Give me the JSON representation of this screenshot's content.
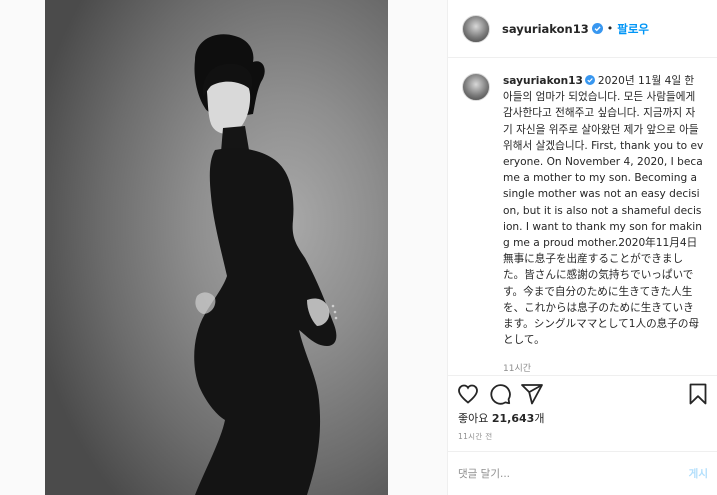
{
  "header": {
    "username": "sayuriakon13",
    "separator": "•",
    "follow_label": "팔로우"
  },
  "caption": {
    "username": "sayuriakon13",
    "text": "2020년 11월 4일 한 아들의 엄마가 되었습니다. 모든 사람들에게 감사한다고 전해주고 싶습니다. 지금까지 자기 자신을 위주로 살아왔던 제가 앞으로 아들 위해서 살겠습니다. First, thank you to everyone. On November 4, 2020, I became a mother to my son. Becoming a single mother was not an easy decision, but it is also not a shameful decision. I want to thank my son for making me a proud mother.2020年11月4日無事に息子を出産することができました。皆さんに感謝の気持ちでいっぱいです。今まで自分のために生きてきた人生を、これからは息子のために生きていきます。シングルママとして1人の息子の母として。",
    "time": "11시간"
  },
  "actions": {
    "like_icon": "heart-icon",
    "comment_icon": "comment-icon",
    "share_icon": "share-icon",
    "save_icon": "bookmark-icon"
  },
  "likes": {
    "prefix": "좋아요 ",
    "count": "21,643",
    "suffix": "개"
  },
  "post_time": "11시간 전",
  "comment": {
    "placeholder": "댓글 달기...",
    "post_label": "게시"
  },
  "colors": {
    "accent": "#0095f6",
    "verified": "#3897f0",
    "post_disabled": "#b2dffc",
    "muted": "#8e8e8e"
  }
}
